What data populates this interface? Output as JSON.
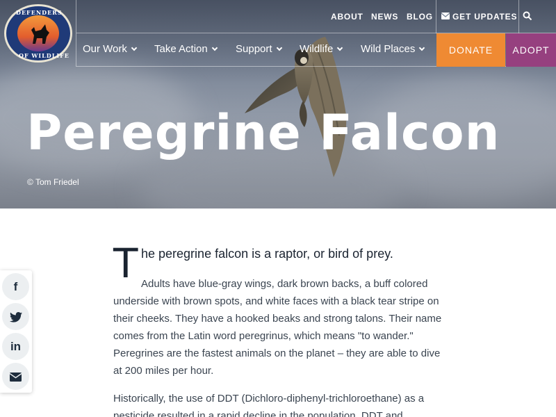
{
  "logo": {
    "top_text": "DEFENDERS",
    "bottom_text": "OF WILDLIFE"
  },
  "topbar": {
    "about": "ABOUT",
    "news": "NEWS",
    "blog": "BLOG",
    "get_updates": "GET UPDATES"
  },
  "nav": {
    "items": [
      {
        "label": "Our Work"
      },
      {
        "label": "Take Action"
      },
      {
        "label": "Support"
      },
      {
        "label": "Wildlife"
      },
      {
        "label": "Wild Places"
      }
    ],
    "donate": "DONATE",
    "adopt": "ADOPT"
  },
  "hero": {
    "title": "Peregrine Falcon",
    "credit": "© Tom Friedel"
  },
  "share": {
    "facebook": "f",
    "twitter": "twitter-icon",
    "linkedin": "in",
    "email": "email-icon"
  },
  "article": {
    "dropcap": "T",
    "lede": "he peregrine falcon is a raptor, or bird of prey.",
    "paragraph1": "Adults have blue-gray wings, dark brown backs, a buff colored underside with brown spots, and white faces with a black tear stripe on their cheeks. They have a hooked beaks and strong talons. Their name comes from the Latin word peregrinus, which means \"to wander.\" Peregrines are the fastest animals on the planet – they are able to dive at 200 miles per hour.",
    "paragraph2": "Historically, the use of DDT (Dichloro-diphenyl-trichloroethane) as a pesticide resulted in a rapid decline in the population. DDT and"
  },
  "colors": {
    "donate": "#ef8a33",
    "adopt": "#96407f",
    "logo_blue": "#1f3a78"
  }
}
